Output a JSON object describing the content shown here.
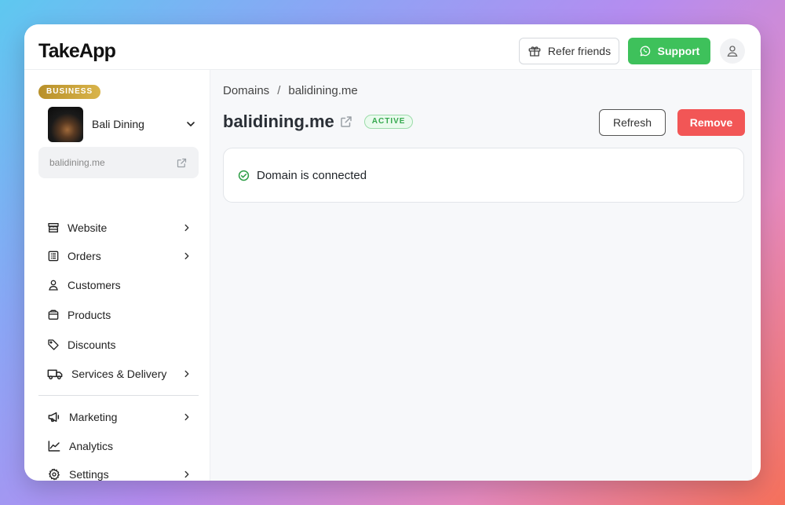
{
  "app": {
    "logo": "TakeApp"
  },
  "header": {
    "refer_label": "Refer friends",
    "support_label": "Support"
  },
  "sidebar": {
    "badge": "BUSINESS",
    "store_name": "Bali Dining",
    "domain": "balidining.me",
    "items": [
      {
        "label": "Website",
        "icon": "storefront-icon",
        "has_chevron": true
      },
      {
        "label": "Orders",
        "icon": "receipt-icon",
        "has_chevron": true
      },
      {
        "label": "Customers",
        "icon": "user-icon",
        "has_chevron": false
      },
      {
        "label": "Products",
        "icon": "box-icon",
        "has_chevron": false
      },
      {
        "label": "Discounts",
        "icon": "tag-icon",
        "has_chevron": false
      },
      {
        "label": "Services & Delivery",
        "icon": "truck-icon",
        "has_chevron": true
      },
      {
        "label": "Marketing",
        "icon": "megaphone-icon",
        "has_chevron": true
      },
      {
        "label": "Analytics",
        "icon": "chart-icon",
        "has_chevron": false
      },
      {
        "label": "Settings",
        "icon": "gear-icon",
        "has_chevron": true
      }
    ]
  },
  "main": {
    "breadcrumb": {
      "parent": "Domains",
      "separator": "/",
      "current": "balidining.me"
    },
    "title": "balidining.me",
    "status": "ACTIVE",
    "refresh_label": "Refresh",
    "remove_label": "Remove",
    "connection_message": "Domain is connected"
  },
  "colors": {
    "support_green": "#3ec15b",
    "remove_red": "#f25656",
    "active_green": "#35a84e",
    "business_gold": "#c9a23a"
  }
}
